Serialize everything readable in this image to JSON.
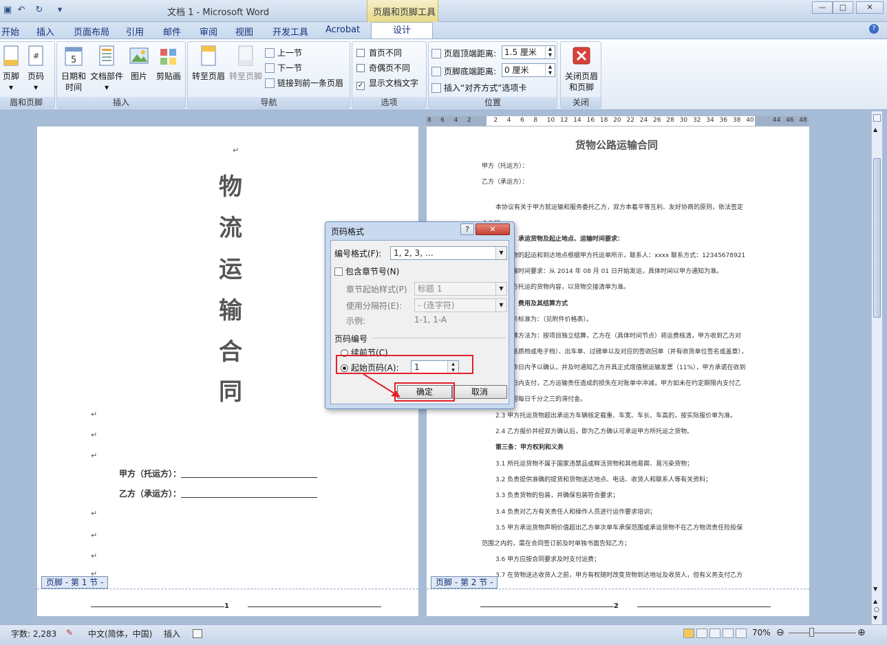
{
  "title_bar": {
    "doc_title": "文档 1 - Microsoft Word",
    "context_tab": "页眉和页脚工具"
  },
  "tabs": [
    "开始",
    "插入",
    "页面布局",
    "引用",
    "邮件",
    "审阅",
    "视图",
    "开发工具",
    "Acrobat"
  ],
  "active_tab": "设计",
  "ribbon": {
    "header_footer_group": {
      "btn": "页脚",
      "btn2": "页码",
      "caption": "眉和页脚"
    },
    "insert_group": {
      "date_time": "日期和\n时间",
      "doc_parts": "文档部件",
      "picture": "图片",
      "clipart": "剪贴画",
      "caption": "插入"
    },
    "nav_group": {
      "goto_header": "转至页眉",
      "goto_footer": "转至页脚",
      "prev_section": "上一节",
      "next_section": "下一节",
      "link_prev": "链接到前一条页眉",
      "caption": "导航"
    },
    "options_group": {
      "first_page": "首页不同",
      "odd_even": "奇偶页不同",
      "show_text": "显示文档文字",
      "caption": "选项"
    },
    "position_group": {
      "header_dist_label": "页眉顶端距离:",
      "header_dist_value": "1.5 厘米",
      "footer_dist_label": "页脚底端距离:",
      "footer_dist_value": "0 厘米",
      "align_tab": "插入“对齐方式”选项卡",
      "caption": "位置"
    },
    "close_group": {
      "close": "关闭页眉\n和页脚",
      "caption": "关闭"
    }
  },
  "ruler_ticks": [
    "8",
    "6",
    "4",
    "2",
    "",
    "2",
    "4",
    "6",
    "8",
    "10",
    "12",
    "14",
    "16",
    "18",
    "20",
    "22",
    "24",
    "26",
    "28",
    "30",
    "32",
    "34",
    "36",
    "38",
    "40",
    "",
    "44",
    "46",
    "48"
  ],
  "page1": {
    "title_chars": [
      "物",
      "流",
      "运",
      "输",
      "合",
      "同"
    ],
    "party_a": "甲方（托运方）：",
    "party_b": "乙方（承运方）：",
    "footer_tab": "页脚 - 第 1 节 -",
    "page_num": "1"
  },
  "page2": {
    "heading": "货物公路运输合同",
    "footer_tab": "页脚 - 第 2 节 -",
    "page_num": "2",
    "lines": [
      "甲方（托运方）：",
      "乙方（承运方）：",
      "本协议有关于甲方就运输和服务委托乙方，双方本着平等互利、友好协商的原则，依法签定",
      "合作同",
      "：承运货物及起止地点、运输时间要求：",
      "物的起运和到达地点根据甲方托运单所示，联系人：xxxx 联系方式：12345678921",
      "输时间要求：从 2014 年 08 月 01 日开始发运，具体时间以甲方通知为准。",
      "方托运的货物内容，以货物交接清单为准。",
      "：费用及其结算方式",
      "价标准为：（见附件价格表）。",
      "算方法为：按项目独立结算，乙方在（具体时间节点）将运费核清，甲方收到乙方对",
      "纸质档或电子档）、出车单、过磅单以及对应的签收回单（并有收货单位签名或盖章），",
      "作日内予以确认，并及时通知乙方开具正式增值税运输发票（11%），甲方承诺在收到",
      "日内支付，乙方运输责任造成的损失在对账单中冲减，甲方如未在约定期限内支付乙",
      "超每日千分之三的滞付金。",
      "2.3 甲方托运货物超出承运方车辆核定载重、车宽、车长、车高的，按实际报价单为准。",
      "2.4 乙方报价并经双方确认后，即为乙方确认可承运甲方所托运之货物。",
      "第三条：甲方权利和义务",
      "3.1 所托运货物不属于国家违禁品或鲜活货物和其他易腐、易污染货物；",
      "3.2 负责提供准确的提货和货物送达地点、电话、收货人和联系人等有关资料；",
      "3.3 负责货物的包装，并确保包装符合要求；",
      "3.4 负责对乙方有关责任人和操作人员进行运作要求培训；",
      "3.5 甲方承运货物声明价值超出乙方单次单车承保范围或承运货物不在乙方物流责任险投保",
      "范围之内的，需在合同签订前及时单独书面告知乙方；",
      "3.6 甲方应按合同要求及时支付运费；",
      "3.7 在货物送达收货人之前，甲方有权随时改变货物到达地址及收货人，但有义务支付乙方"
    ]
  },
  "dialog": {
    "title": "页码格式",
    "help": "?",
    "number_format_label": "编号格式(F):",
    "number_format_value": "1, 2, 3, …",
    "include_chapter": "包含章节号(N)",
    "chapter_style_label": "章节起始样式(P)",
    "chapter_style_value": "标题 1",
    "separator_label": "使用分隔符(E):",
    "separator_value": "-  (连字符)",
    "example_label": "示例:",
    "example_value": "1-1, 1-A",
    "numbering_section": "页码编号",
    "continue_prev": "续前节(C)",
    "start_at": "起始页码(A):",
    "start_value": "1",
    "ok": "确定",
    "cancel": "取消"
  },
  "status": {
    "words": "字数: 2,283",
    "lang": "中文(简体，中国)",
    "mode": "插入",
    "zoom": "70%"
  },
  "colors": {
    "highlight": "#e2202a",
    "ribbon_text": "#15317a"
  }
}
